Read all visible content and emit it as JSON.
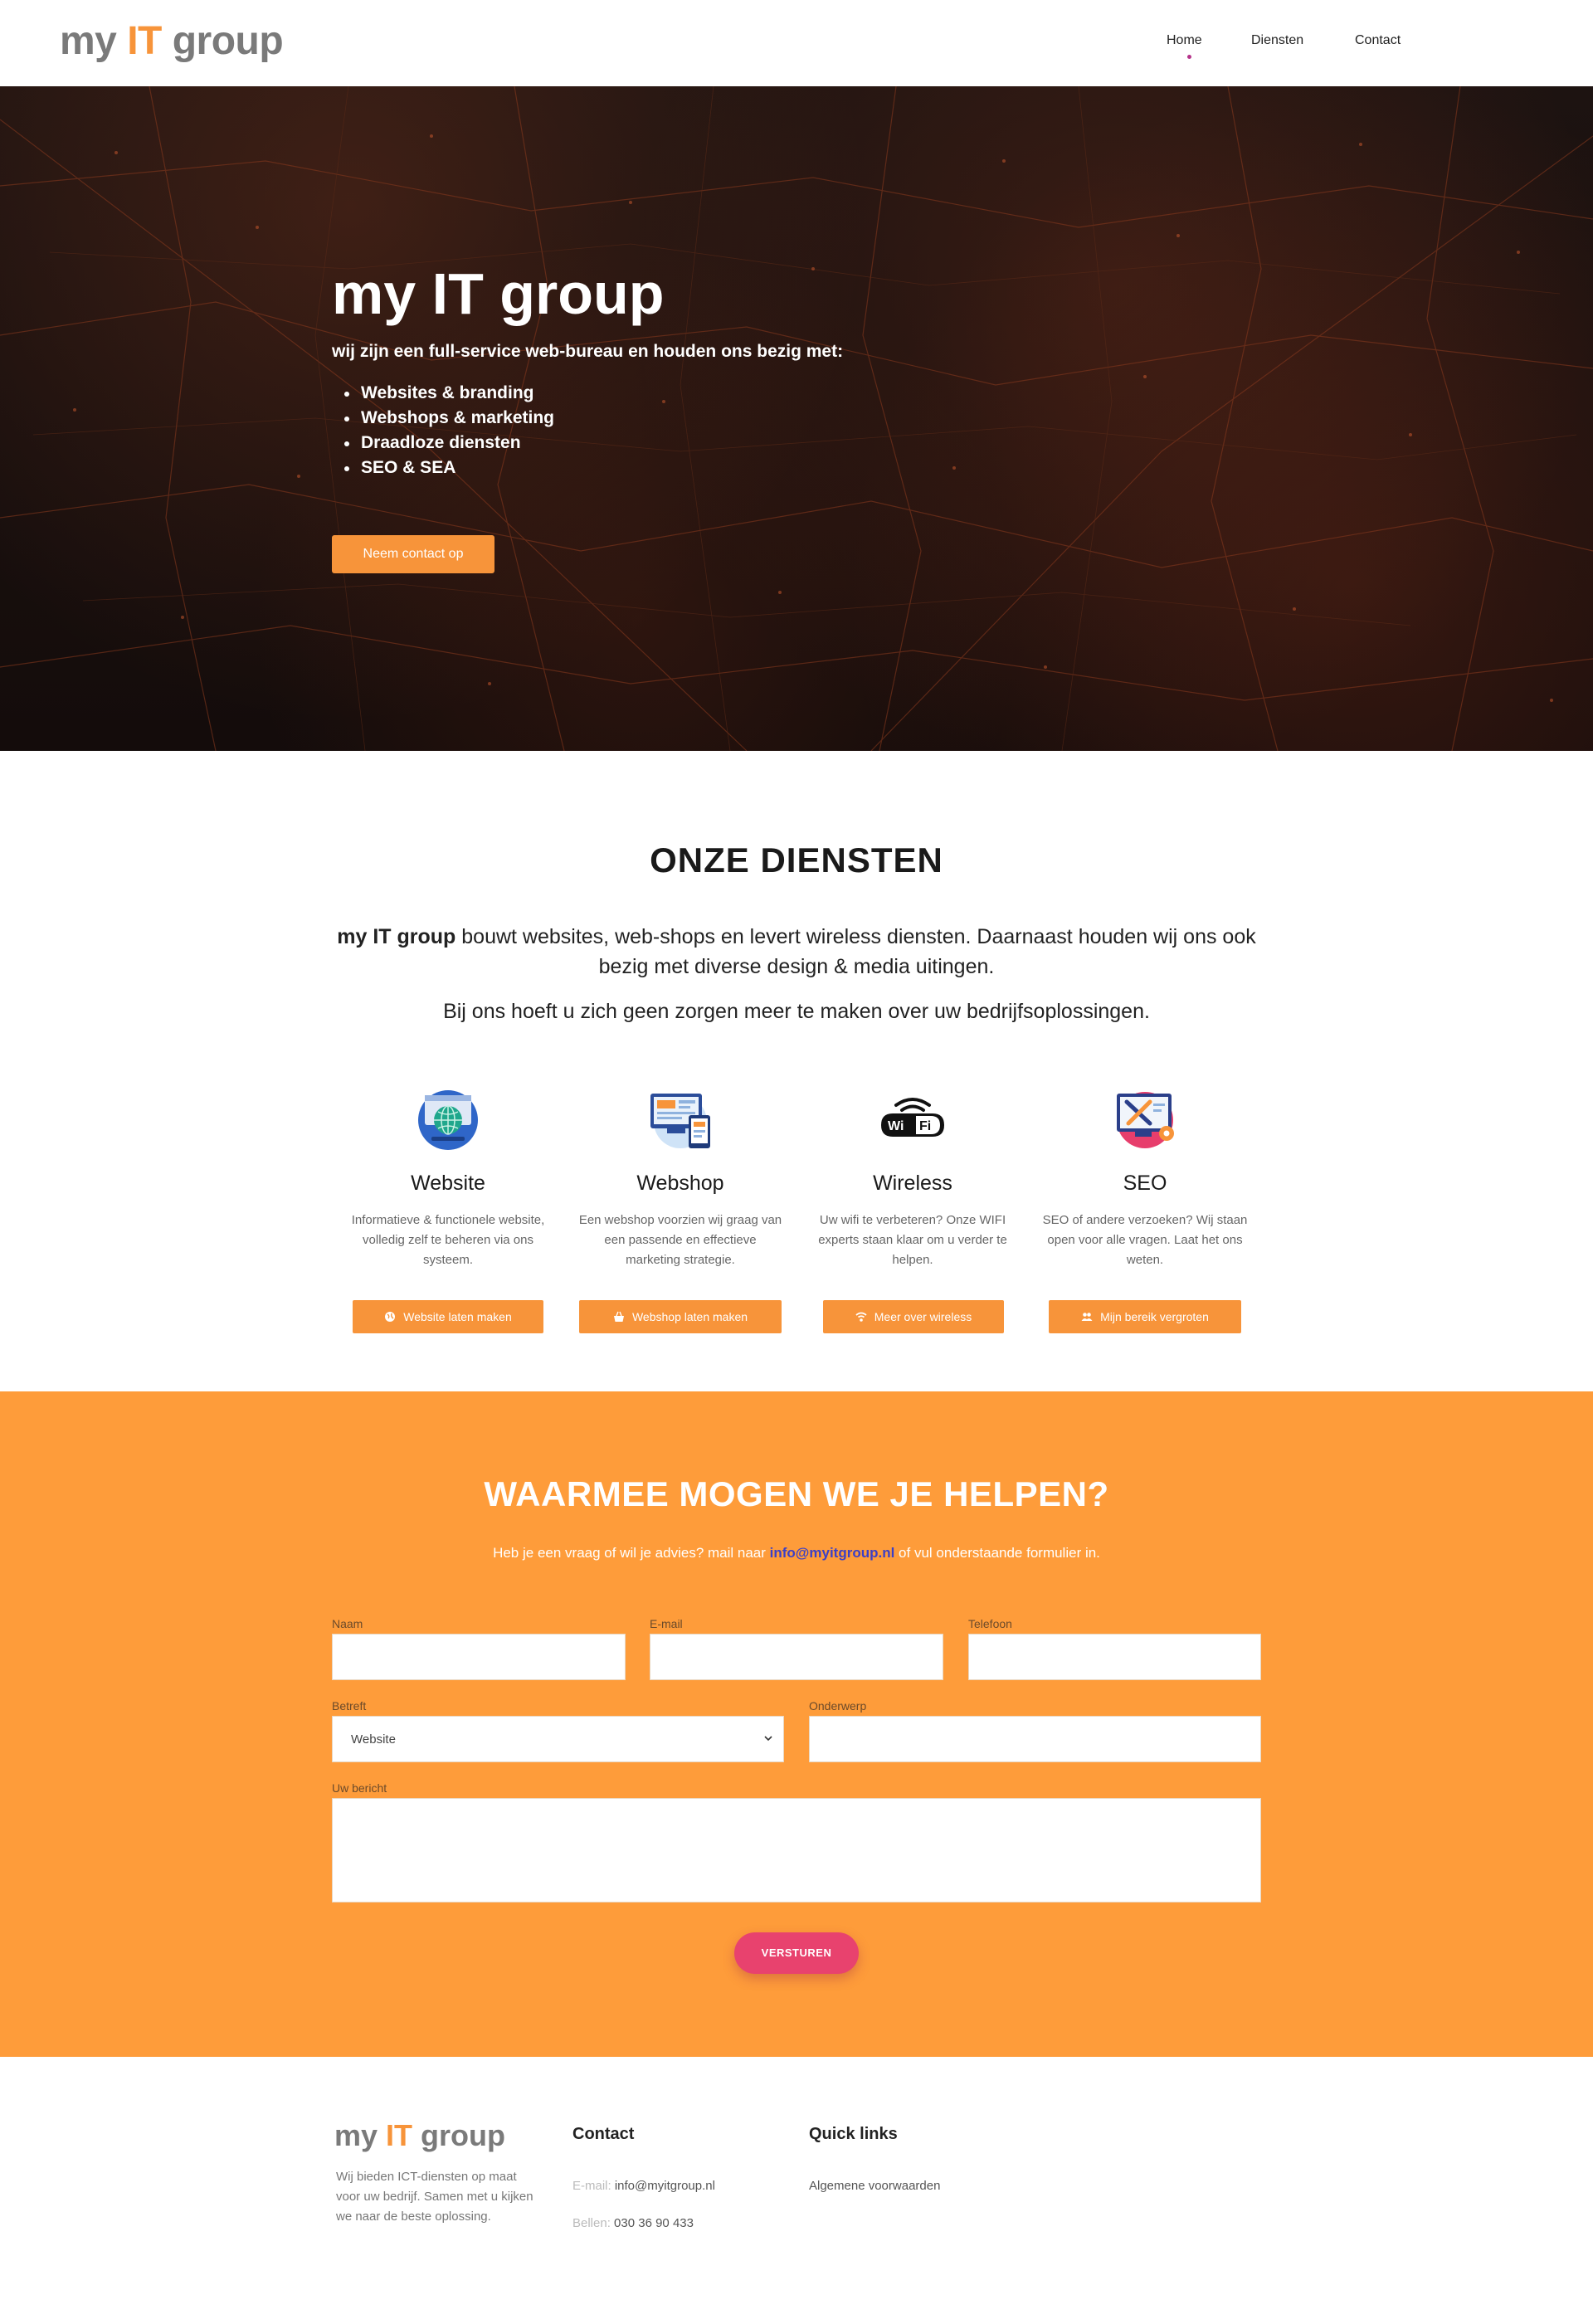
{
  "nav": {
    "logo": {
      "part1": "my ",
      "part2": "IT",
      "part3": " group"
    },
    "items": [
      "Home",
      "Diensten",
      "Contact"
    ],
    "active": "Home"
  },
  "hero": {
    "title": "my IT group",
    "subtitle": "wij zijn een full-service web-bureau en houden ons bezig met:",
    "list": [
      "Websites & branding",
      "Webshops & marketing",
      "Draadloze diensten",
      "SEO & SEA"
    ],
    "button": "Neem contact op"
  },
  "diensten": {
    "title": "ONZE DIENSTEN",
    "intro_strong": "my IT group",
    "intro_rest": " bouwt websites, web-shops en levert wireless diensten. Daarnaast houden wij ons ook bezig met diverse design & media uitingen.",
    "intro2": "Bij ons hoeft u zich geen zorgen meer te maken over uw bedrijfsoplossingen.",
    "services": [
      {
        "title": "Website",
        "desc": "Informatieve & functionele website, volledig zelf te beheren via ons systeem.",
        "button": "Website laten maken",
        "icon": "globe-icon"
      },
      {
        "title": "Webshop",
        "desc": "Een webshop voorzien wij graag van een passende en effectieve marketing strategie.",
        "button": "Webshop laten maken",
        "icon": "shopping-basket-icon"
      },
      {
        "title": "Wireless",
        "desc": "Uw wifi te verbeteren? Onze WIFI experts staan klaar om u verder te helpen.",
        "button": "Meer over wireless",
        "icon": "wifi-icon"
      },
      {
        "title": "SEO",
        "desc": "SEO of andere verzoeken? Wij staan open voor alle vragen. Laat het ons weten.",
        "button": "Mijn bereik vergroten",
        "icon": "users-icon"
      }
    ]
  },
  "contact": {
    "title": "WAARMEE MOGEN WE JE HELPEN?",
    "sub_before": "Heb je een vraag of wil je advies? mail naar ",
    "email": "info@myitgroup.nl",
    "sub_after": " of vul onderstaande formulier in.",
    "labels": {
      "naam": "Naam",
      "email": "E-mail",
      "telefoon": "Telefoon",
      "betreft": "Betreft",
      "onderwerp": "Onderwerp",
      "bericht": "Uw bericht"
    },
    "betreft_value": "Website",
    "submit": "VERSTUREN"
  },
  "footer": {
    "logo": {
      "part1": "my ",
      "part2": "IT",
      "part3": " group"
    },
    "about": "Wij bieden ICT-diensten op maat voor uw bedrijf. Samen met u kijken we naar de beste oplossing.",
    "contact_title": "Contact",
    "email_label": "E-mail:",
    "email_value": "info@myitgroup.nl",
    "phone_label": "Bellen:",
    "phone_value": "030 36 90 433",
    "links_title": "Quick links",
    "links": [
      "Algemene voorwaarden"
    ]
  },
  "colors": {
    "accent": "#f7943a",
    "contact_bg": "#fe9c3a",
    "submit": "#e8426e",
    "link": "#3b3fc7"
  }
}
